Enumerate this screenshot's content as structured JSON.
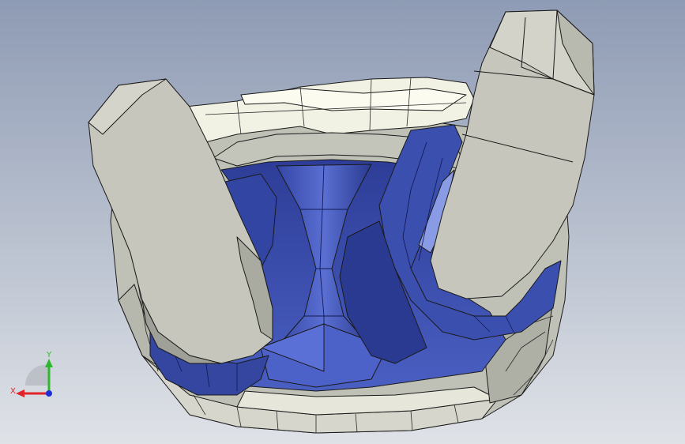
{
  "viewport": {
    "background_top": "#8e9bb4",
    "background_bottom": "#dfe2e7",
    "colors": {
      "part_light": "#c9c9c1",
      "part_light_shade": "#a9aaa1",
      "part_cream": "#ececdd",
      "part_blue": "#3a4fa8",
      "part_blue_dark": "#1e2a6e",
      "part_blue_light": "#7d8fe0",
      "edge": "#1a1a1a"
    }
  },
  "triad": {
    "x_label": "X",
    "y_label": "Y",
    "x_color": "#e0242a",
    "y_color": "#2fb82f",
    "z_color": "#1c2fd6"
  }
}
